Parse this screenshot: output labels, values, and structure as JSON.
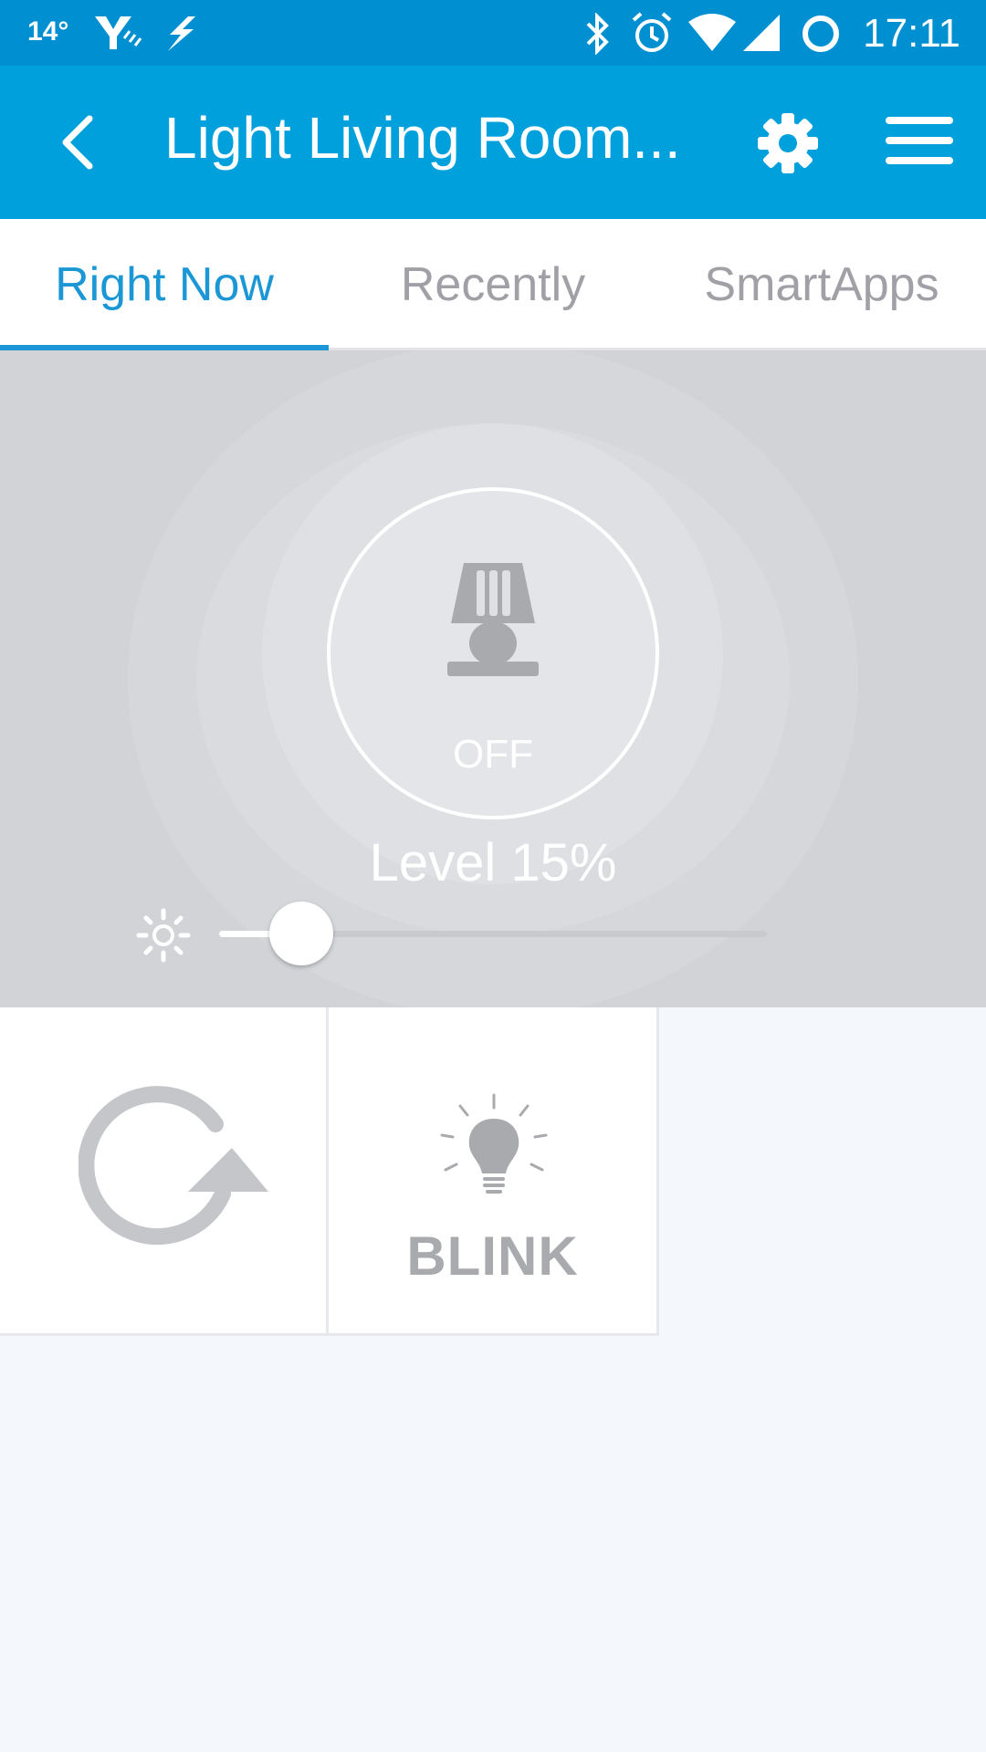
{
  "status_bar": {
    "temperature": "14°",
    "time": "17:11",
    "icons": [
      "weather-icon",
      "flash-icon",
      "bluetooth-icon",
      "alarm-icon",
      "wifi-icon",
      "signal-icon",
      "battery-icon"
    ]
  },
  "app_bar": {
    "title": "Light Living Room...",
    "back_icon": "chevron-left-icon",
    "settings_icon": "gear-icon",
    "menu_icon": "hamburger-menu-icon"
  },
  "tabs": [
    {
      "label": "Right Now",
      "active": true
    },
    {
      "label": "Recently",
      "active": false
    },
    {
      "label": "SmartApps",
      "active": false
    }
  ],
  "device": {
    "state": "OFF",
    "level_label": "Level 15%",
    "level": 15,
    "icon": "lamp-icon"
  },
  "tiles": [
    {
      "name": "refresh",
      "icon": "refresh-icon",
      "label": ""
    },
    {
      "name": "blink",
      "icon": "lightbulb-icon",
      "label": "BLINK"
    }
  ],
  "colors": {
    "status_bar": "#0090d2",
    "app_bar": "#00a0dc",
    "accent": "#1a97d4",
    "hero_background": "#d2d3d7",
    "icon_gray": "#a9aaae"
  }
}
